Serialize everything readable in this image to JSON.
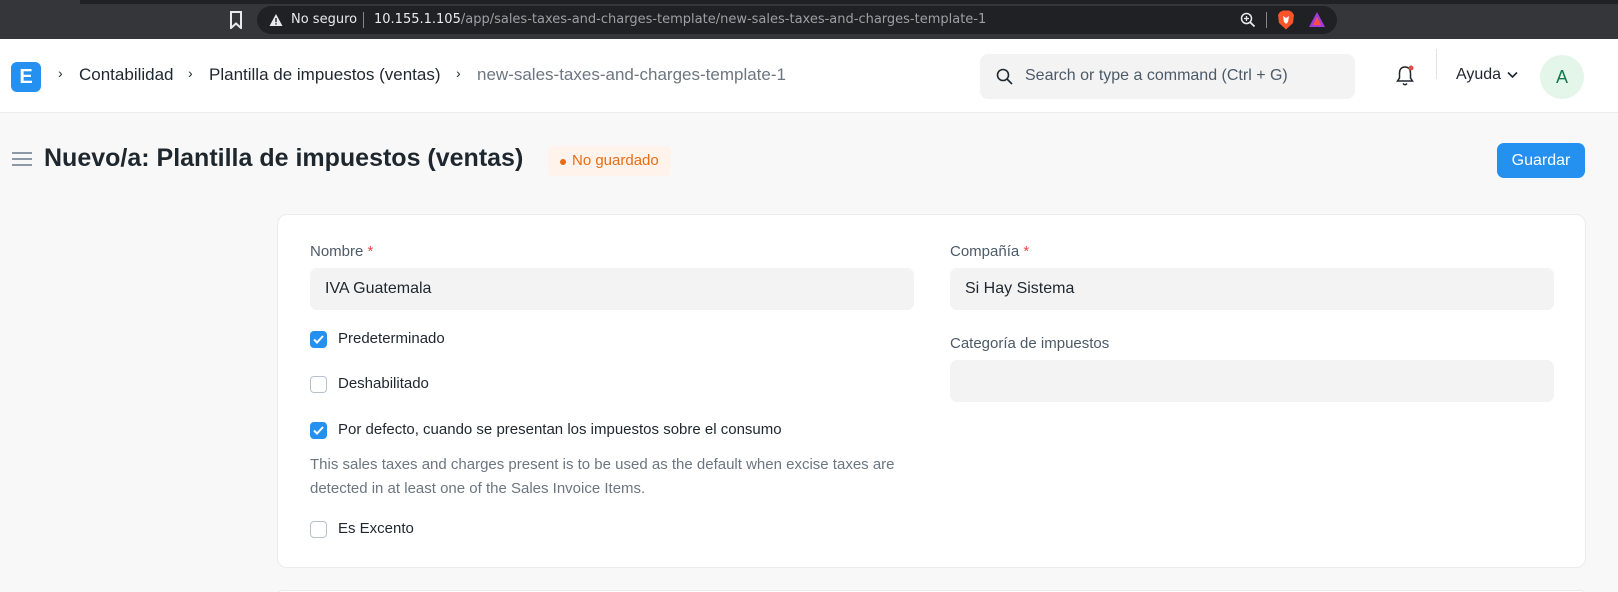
{
  "browser": {
    "security_label": "No seguro",
    "url_host": "10.155.1.105",
    "url_path": "/app/sales-taxes-and-charges-template/new-sales-taxes-and-charges-template-1"
  },
  "navbar": {
    "logo_letter": "E",
    "breadcrumbs": [
      "Contabilidad",
      "Plantilla de impuestos (ventas)",
      "new-sales-taxes-and-charges-template-1"
    ],
    "search_placeholder": "Search or type a command (Ctrl + G)",
    "help_label": "Ayuda",
    "avatar_initial": "A"
  },
  "page": {
    "title": "Nuevo/a: Plantilla de impuestos (ventas)",
    "status": "No guardado",
    "save_label": "Guardar"
  },
  "form": {
    "nombre_label": "Nombre",
    "nombre_value": "IVA Guatemala",
    "compania_label": "Compañía",
    "compania_value": "Si Hay Sistema",
    "required_mark": "*",
    "categoria_label": "Categoría de impuestos",
    "categoria_value": "",
    "checkboxes": [
      {
        "label": "Predeterminado",
        "checked": true
      },
      {
        "label": "Deshabilitado",
        "checked": false
      },
      {
        "label": "Por defecto, cuando se presentan los impuestos sobre el consumo",
        "checked": true
      },
      {
        "label": "Es Excento",
        "checked": false
      }
    ],
    "excise_help": "This sales taxes and charges present is to be used as the default when excise taxes are detected in at least one of the Sales Invoice Items."
  },
  "colors": {
    "primary": "#2490ef",
    "status_orange": "#e86c13",
    "required_red": "#e24c4c"
  },
  "icons": [
    "bookmark-icon",
    "warning-icon",
    "zoom-icon",
    "brave-shield-icon",
    "brave-rewards-icon",
    "search-icon",
    "bell-icon",
    "chevron-down-icon",
    "sidebar-toggle-icon",
    "check-icon"
  ]
}
